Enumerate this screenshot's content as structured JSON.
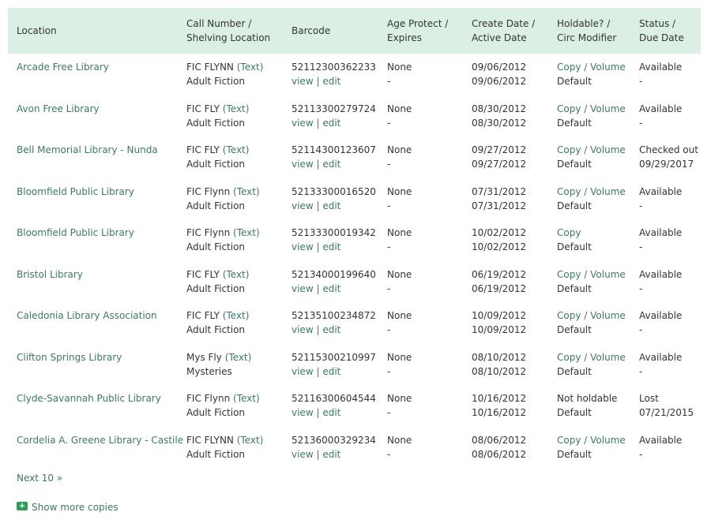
{
  "headers": {
    "location": [
      "Location"
    ],
    "call_number": [
      "Call Number /",
      "Shelving Location"
    ],
    "barcode": [
      "Barcode"
    ],
    "age_protect": [
      "Age Protect /",
      "Expires"
    ],
    "create_date": [
      "Create Date /",
      "Active Date"
    ],
    "holdable": [
      "Holdable? /",
      "Circ Modifier"
    ],
    "status": [
      "Status /",
      "Due Date"
    ]
  },
  "rows": [
    {
      "location": "Arcade Free Library",
      "call_number": "FIC FLYNN",
      "text_link": "(Text)",
      "shelving": "Adult Fiction",
      "barcode": "52112300362233",
      "view": "view",
      "edit": "edit",
      "age_protect": "None",
      "expires": "-",
      "create_date": "09/06/2012",
      "active_date": "09/06/2012",
      "holdable": "Copy",
      "volume": "Volume",
      "circ_modifier": "Default",
      "status": "Available",
      "due_date": "-"
    },
    {
      "location": "Avon Free Library",
      "call_number": "FIC FLY",
      "text_link": "(Text)",
      "shelving": "Adult Fiction",
      "barcode": "52113300279724",
      "view": "view",
      "edit": "edit",
      "age_protect": "None",
      "expires": "-",
      "create_date": "08/30/2012",
      "active_date": "08/30/2012",
      "holdable": "Copy",
      "volume": "Volume",
      "circ_modifier": "Default",
      "status": "Available",
      "due_date": "-"
    },
    {
      "location": "Bell Memorial Library - Nunda",
      "call_number": "FIC FLY",
      "text_link": "(Text)",
      "shelving": "Adult Fiction",
      "barcode": "52114300123607",
      "view": "view",
      "edit": "edit",
      "age_protect": "None",
      "expires": "-",
      "create_date": "09/27/2012",
      "active_date": "09/27/2012",
      "holdable": "Copy",
      "volume": "Volume",
      "circ_modifier": "Default",
      "status": "Checked out",
      "due_date": "09/29/2017"
    },
    {
      "location": "Bloomfield Public Library",
      "call_number": "FIC Flynn",
      "text_link": "(Text)",
      "shelving": "Adult Fiction",
      "barcode": "52133300016520",
      "view": "view",
      "edit": "edit",
      "age_protect": "None",
      "expires": "-",
      "create_date": "07/31/2012",
      "active_date": "07/31/2012",
      "holdable": "Copy",
      "volume": "Volume",
      "circ_modifier": "Default",
      "status": "Available",
      "due_date": "-"
    },
    {
      "location": "Bloomfield Public Library",
      "call_number": "FIC Flynn",
      "text_link": "(Text)",
      "shelving": "Adult Fiction",
      "barcode": "52133300019342",
      "view": "view",
      "edit": "edit",
      "age_protect": "None",
      "expires": "-",
      "create_date": "10/02/2012",
      "active_date": "10/02/2012",
      "holdable": "Copy",
      "volume": "",
      "circ_modifier": "Default",
      "status": "Available",
      "due_date": "-"
    },
    {
      "location": "Bristol Library",
      "call_number": "FIC FLY",
      "text_link": "(Text)",
      "shelving": "Adult Fiction",
      "barcode": "52134000199640",
      "view": "view",
      "edit": "edit",
      "age_protect": "None",
      "expires": "-",
      "create_date": "06/19/2012",
      "active_date": "06/19/2012",
      "holdable": "Copy",
      "volume": "Volume",
      "circ_modifier": "Default",
      "status": "Available",
      "due_date": "-"
    },
    {
      "location": "Caledonia Library Association",
      "call_number": "FIC FLY",
      "text_link": "(Text)",
      "shelving": "Adult Fiction",
      "barcode": "52135100234872",
      "view": "view",
      "edit": "edit",
      "age_protect": "None",
      "expires": "-",
      "create_date": "10/09/2012",
      "active_date": "10/09/2012",
      "holdable": "Copy",
      "volume": "Volume",
      "circ_modifier": "Default",
      "status": "Available",
      "due_date": "-"
    },
    {
      "location": "Clifton Springs Library",
      "call_number": "Mys Fly",
      "text_link": "(Text)",
      "shelving": "Mysteries",
      "barcode": "52115300210997",
      "view": "view",
      "edit": "edit",
      "age_protect": "None",
      "expires": "-",
      "create_date": "08/10/2012",
      "active_date": "08/10/2012",
      "holdable": "Copy",
      "volume": "Volume",
      "circ_modifier": "Default",
      "status": "Available",
      "due_date": "-"
    },
    {
      "location": "Clyde-Savannah Public Library",
      "call_number": "FIC Flynn",
      "text_link": "(Text)",
      "shelving": "Adult Fiction",
      "barcode": "52116300604544",
      "view": "view",
      "edit": "edit",
      "age_protect": "None",
      "expires": "-",
      "create_date": "10/16/2012",
      "active_date": "10/16/2012",
      "holdable": "Not holdable",
      "volume": "",
      "circ_modifier": "Default",
      "status": "Lost",
      "due_date": "07/21/2015"
    },
    {
      "location": "Cordelia A. Greene Library - Castile",
      "call_number": "FIC FLYNN",
      "text_link": "(Text)",
      "shelving": "Adult Fiction",
      "barcode": "52136000329234",
      "view": "view",
      "edit": "edit",
      "age_protect": "None",
      "expires": "-",
      "create_date": "08/06/2012",
      "active_date": "08/06/2012",
      "holdable": "Copy",
      "volume": "Volume",
      "circ_modifier": "Default",
      "status": "Available",
      "due_date": "-"
    }
  ],
  "pager": {
    "next_label": "Next 10 »"
  },
  "show_more": {
    "label": "Show more copies",
    "icon": "plus-icon"
  },
  "colors": {
    "header_bg": "#dcefe4",
    "link": "#3b7a60",
    "text": "#333333",
    "icon": "#2f9a58"
  }
}
